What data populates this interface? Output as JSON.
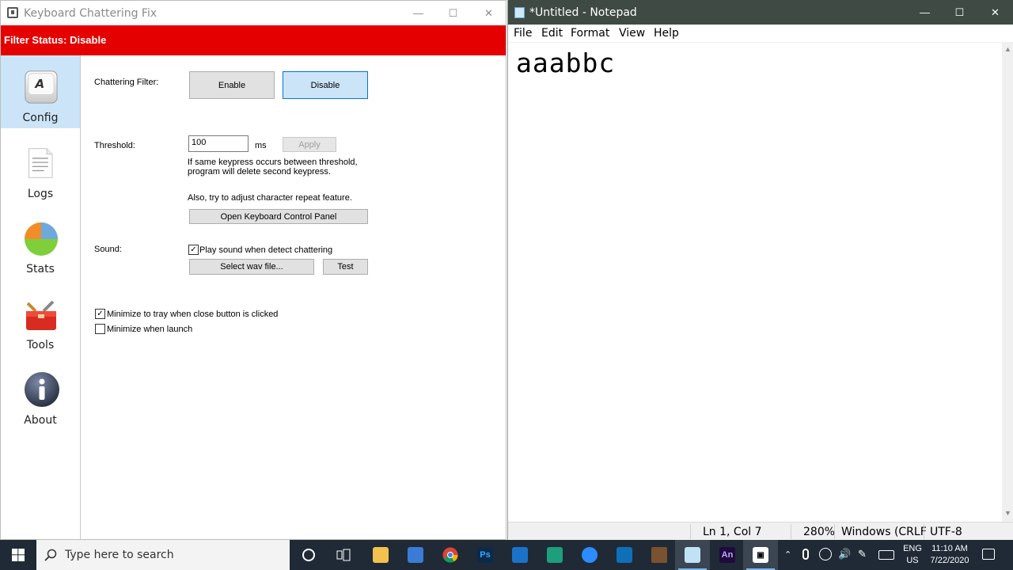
{
  "kcf": {
    "title": "Keyboard Chattering Fix",
    "filter_status": "Filter Status: Disable",
    "status_color": "#e50000",
    "nav": [
      {
        "label": "Config",
        "icon": "keyboard-key-icon",
        "active": true
      },
      {
        "label": "Logs",
        "icon": "document-icon",
        "active": false
      },
      {
        "label": "Stats",
        "icon": "pie-chart-icon",
        "active": false
      },
      {
        "label": "Tools",
        "icon": "toolbox-icon",
        "active": false
      },
      {
        "label": "About",
        "icon": "info-icon",
        "active": false
      }
    ],
    "chattering_filter_label": "Chattering Filter:",
    "enable_label": "Enable",
    "disable_label": "Disable",
    "threshold_label": "Threshold:",
    "threshold_value": "100",
    "threshold_unit": "ms",
    "apply_label": "Apply",
    "threshold_help": "If same keypress occurs between threshold, program will delete second keypress.",
    "repeat_hint": "Also, try to adjust character repeat feature.",
    "open_panel_label": "Open Keyboard Control Panel",
    "sound_label": "Sound:",
    "play_sound_label": "Play sound when detect chattering",
    "play_sound_checked": true,
    "select_wav_label": "Select wav file...",
    "test_label": "Test",
    "minimize_tray_label": "Minimize to tray when close button is clicked",
    "minimize_tray_checked": true,
    "minimize_launch_label": "Minimize when launch",
    "minimize_launch_checked": false
  },
  "notepad": {
    "title": "*Untitled - Notepad",
    "menu": [
      "File",
      "Edit",
      "Format",
      "View",
      "Help"
    ],
    "text": "aaabbc",
    "status_position": "Ln 1, Col 7",
    "status_zoom": "280%",
    "status_eol": "Windows (CRLF",
    "status_encoding": "UTF-8"
  },
  "taskbar": {
    "search_placeholder": "Type here to search",
    "lang_top": "ENG",
    "lang_bottom": "US",
    "time": "11:10 AM",
    "date": "7/22/2020"
  },
  "colors": {
    "notepad_titlebar": "#3f4a44",
    "taskbar": "#1f2a36",
    "nav_active": "#cce4f7"
  }
}
